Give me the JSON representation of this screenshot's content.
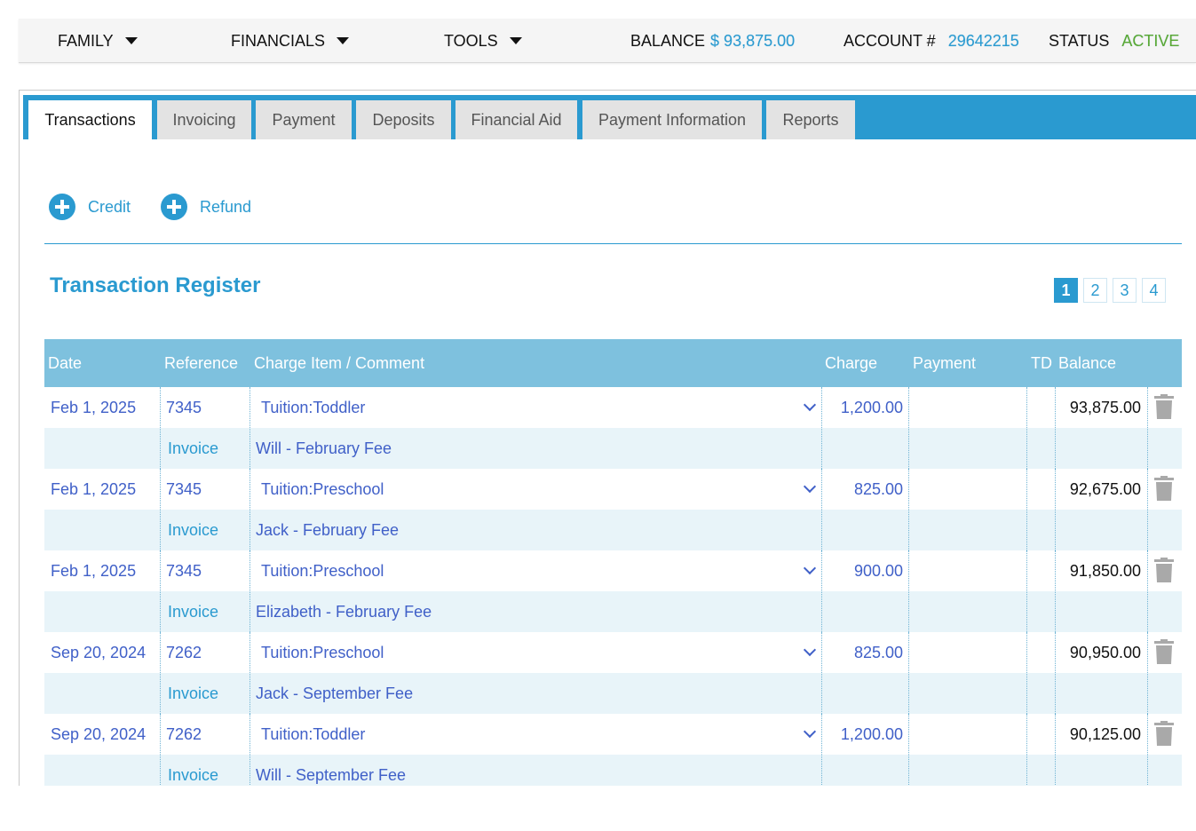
{
  "topbar": {
    "nav": [
      {
        "label": "FAMILY"
      },
      {
        "label": "FINANCIALS"
      },
      {
        "label": "TOOLS"
      }
    ],
    "balance_label": "BALANCE",
    "balance_value": "$ 93,875.00",
    "account_label": "ACCOUNT #",
    "account_value": "29642215",
    "status_label": "STATUS",
    "status_value": "ACTIVE"
  },
  "tabs": [
    {
      "label": "Transactions"
    },
    {
      "label": "Invoicing"
    },
    {
      "label": "Payment"
    },
    {
      "label": "Deposits"
    },
    {
      "label": "Financial Aid"
    },
    {
      "label": "Payment Information"
    },
    {
      "label": "Reports"
    }
  ],
  "selected_tab": "Transactions",
  "actions": {
    "credit_label": "Credit",
    "refund_label": "Refund"
  },
  "register": {
    "title": "Transaction Register",
    "pages": [
      "1",
      "2",
      "3",
      "4"
    ],
    "current_page": "1",
    "columns": {
      "date": "Date",
      "reference": "Reference",
      "charge_item": "Charge Item / Comment",
      "charge": "Charge",
      "payment": "Payment",
      "td": "TD",
      "balance": "Balance"
    },
    "rows": [
      {
        "date": "Feb 1, 2025",
        "reference": "7345",
        "item": "Tuition:Toddler",
        "charge": "1,200.00",
        "payment": "",
        "balance": "93,875.00",
        "type": "Invoice",
        "comment": "Will - February Fee"
      },
      {
        "date": "Feb 1, 2025",
        "reference": "7345",
        "item": "Tuition:Preschool",
        "charge": "825.00",
        "payment": "",
        "balance": "92,675.00",
        "type": "Invoice",
        "comment": "Jack - February Fee"
      },
      {
        "date": "Feb 1, 2025",
        "reference": "7345",
        "item": "Tuition:Preschool",
        "charge": "900.00",
        "payment": "",
        "balance": "91,850.00",
        "type": "Invoice",
        "comment": "Elizabeth - February Fee"
      },
      {
        "date": "Sep 20, 2024",
        "reference": "7262",
        "item": "Tuition:Preschool",
        "charge": "825.00",
        "payment": "",
        "balance": "90,950.00",
        "type": "Invoice",
        "comment": "Jack - September Fee"
      },
      {
        "date": "Sep 20, 2024",
        "reference": "7262",
        "item": "Tuition:Toddler",
        "charge": "1,200.00",
        "payment": "",
        "balance": "90,125.00",
        "type": "Invoice",
        "comment": "Will - September Fee"
      }
    ]
  },
  "colors": {
    "accent": "#2a9ad0",
    "header_bg": "#7ec1de",
    "active_status": "#5aa832",
    "link_text": "#4060c8",
    "sub_row_bg": "#e8f4f9"
  },
  "icons": {
    "nav_caret": "caret-down-icon",
    "add": "plus-circle-icon",
    "dropdown": "chevron-down-icon",
    "delete": "trash-icon"
  }
}
